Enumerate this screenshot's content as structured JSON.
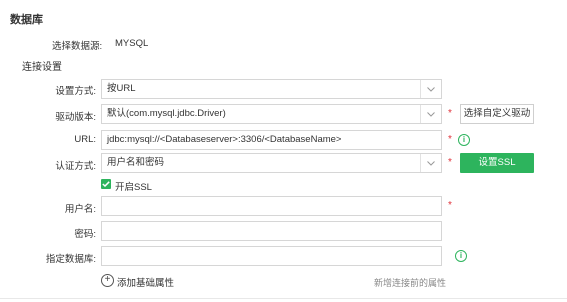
{
  "section": {
    "title": "数据库"
  },
  "datasource": {
    "label": "选择数据源:",
    "value": "MYSQL"
  },
  "connection": {
    "title": "连接设置",
    "method": {
      "label": "设置方式:",
      "value": "按URL"
    },
    "driver": {
      "label": "驱动版本:",
      "value": "默认(com.mysql.jdbc.Driver)",
      "custom_button": "选择自定义驱动"
    },
    "url": {
      "label": "URL:",
      "value": "jdbc:mysql://<Databaseserver>:3306/<DatabaseName>"
    },
    "auth": {
      "label": "认证方式:",
      "value": "用户名和密码",
      "ssl_button": "设置SSL"
    },
    "ssl_checkbox": {
      "label": "开启SSL",
      "checked": true
    },
    "username": {
      "label": "用户名:",
      "value": ""
    },
    "password": {
      "label": "密码:",
      "value": ""
    },
    "database": {
      "label": "指定数据库:",
      "value": ""
    },
    "add_property": {
      "label": "添加基础属性"
    },
    "new_property_hint": "新增连接前的属性"
  },
  "colors": {
    "accent": "#2db45d",
    "required": "#e0313a"
  }
}
